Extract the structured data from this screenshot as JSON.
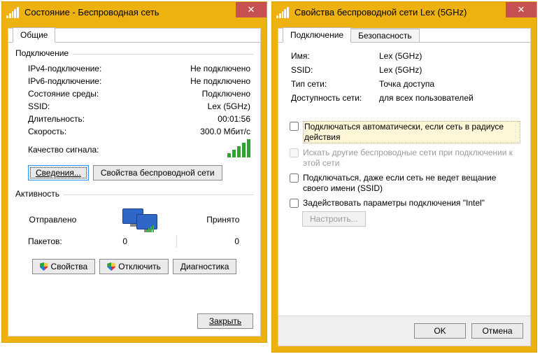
{
  "win1": {
    "title": "Состояние - Беспроводная сеть",
    "tab": "Общие",
    "group_connection": "Подключение",
    "fields": {
      "ipv4_label": "IPv4-подключение:",
      "ipv4_value": "Не подключено",
      "ipv6_label": "IPv6-подключение:",
      "ipv6_value": "Не подключено",
      "media_label": "Состояние среды:",
      "media_value": "Подключено",
      "ssid_label": "SSID:",
      "ssid_value": "Lex (5GHz)",
      "duration_label": "Длительность:",
      "duration_value": "00:01:56",
      "speed_label": "Скорость:",
      "speed_value": "300.0 Мбит/с",
      "signal_label": "Качество сигнала:"
    },
    "btn_details": "Сведения...",
    "btn_wprops": "Свойства беспроводной сети",
    "group_activity": "Активность",
    "activity": {
      "sent": "Отправлено",
      "recv": "Принято",
      "packets_label": "Пакетов:",
      "sent_val": "0",
      "recv_val": "0"
    },
    "btn_props": "Свойства",
    "btn_disable": "Отключить",
    "btn_diag": "Диагностика",
    "btn_close": "Закрыть"
  },
  "win2": {
    "title": "Свойства беспроводной сети Lex (5GHz)",
    "tab_conn": "Подключение",
    "tab_sec": "Безопасность",
    "fields": {
      "name_label": "Имя:",
      "name_value": "Lex (5GHz)",
      "ssid_label": "SSID:",
      "ssid_value": "Lex (5GHz)",
      "nettype_label": "Тип сети:",
      "nettype_value": "Точка доступа",
      "avail_label": "Доступность сети:",
      "avail_value": "для всех пользователей"
    },
    "checks": {
      "auto": "Подключаться автоматически, если сеть в радиусе действия",
      "search": "Искать другие беспроводные сети при подключении к этой сети",
      "hidden": "Подключаться, даже если сеть не ведет вещание своего имени (SSID)",
      "intel": "Задействовать параметры подключения \"Intel\""
    },
    "btn_configure": "Настроить...",
    "btn_ok": "OK",
    "btn_cancel": "Отмена"
  }
}
